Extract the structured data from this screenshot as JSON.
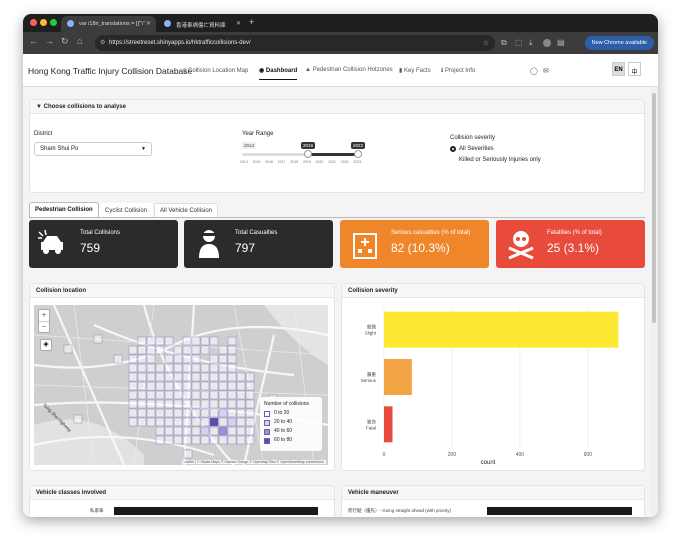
{
  "browser": {
    "tabs": [
      {
        "title": "var i18n_translations = [{\"\\\""
      },
      {
        "title": "香港車禍傷亡資料庫"
      }
    ],
    "url": "https://streetreset.shinyapps.io/hktrafficcollisions-dev/",
    "new_chrome_label": "New Chrome available"
  },
  "app": {
    "brand": "Hong Kong Traffic Injury Collision Database",
    "nav": [
      {
        "label": "Collision Location Map",
        "icon": "map-icon"
      },
      {
        "label": "Dashboard",
        "icon": "gauge-icon"
      },
      {
        "label": "Pedestrian Collision Hotzones",
        "icon": "warning-icon"
      },
      {
        "label": "Key Facts",
        "icon": "book-icon"
      },
      {
        "label": "Project Info",
        "icon": "info-icon"
      }
    ],
    "lang": {
      "en": "EN",
      "zh": "中"
    }
  },
  "filters": {
    "header": "Choose collisions to analyse",
    "district_label": "District",
    "district_value": "Sham Shui Po",
    "year_label": "Year Range",
    "year_min": "2014",
    "year_from": "2019",
    "year_to": "2023",
    "year_ticks": [
      "2014",
      "2015",
      "2016",
      "2017",
      "2018",
      "2019",
      "2020",
      "2021",
      "2022",
      "2023"
    ],
    "severity_label": "Collision severity",
    "severity_options": [
      "All Severities",
      "Killed or Seriously Injuries only"
    ],
    "severity_selected": "All Severities"
  },
  "tabs": [
    {
      "label": "Pedestrian Collision",
      "active": true
    },
    {
      "label": "Cyclist Collision",
      "active": false
    },
    {
      "label": "All Vehicle Collision",
      "active": false
    }
  ],
  "value_boxes": [
    {
      "title": "Total Collisions",
      "value": "759",
      "color": "#2b2b2b",
      "icon": "car-crash-icon"
    },
    {
      "title": "Total Casualties",
      "value": "797",
      "color": "#2b2b2b",
      "icon": "injured-person-icon"
    },
    {
      "title": "Serious casualties (% of total)",
      "value": "82 (10.3%)",
      "color": "#f0862a",
      "icon": "hospital-icon"
    },
    {
      "title": "Fatalities (% of total)",
      "value": "25 (3.1%)",
      "color": "#e84a3c",
      "icon": "skull-crossbones-icon"
    }
  ],
  "map_card": {
    "title": "Collision location",
    "legend_title": "Number of collisions",
    "legend": [
      "0 to 20",
      "20 to 40",
      "40 to 60",
      "60 to 80"
    ],
    "legend_colors": [
      "#ffffff",
      "#d6d1ee",
      "#9a8fd0",
      "#5b4cb0"
    ],
    "attribution": "Leaflet | © Stadia Maps © Stamen Design © OpenMapTiles © OpenStreetMap contributors",
    "place_label": "Tsing Sha Highway",
    "zoom_in": "+",
    "zoom_out": "−"
  },
  "severity_card": {
    "title": "Collision severity"
  },
  "chart_data": {
    "type": "bar",
    "orientation": "horizontal",
    "categories": [
      "Slight",
      "Serious",
      "Fatal"
    ],
    "category_labels_zh": [
      "輕微",
      "嚴重",
      "致命"
    ],
    "values": [
      690,
      82,
      25
    ],
    "colors": [
      "#fde833",
      "#f2a444",
      "#e84a3c"
    ],
    "xlabel": "count",
    "xticks": [
      0,
      200,
      400,
      600
    ],
    "xlim": [
      0,
      730
    ],
    "grid": true
  },
  "bottom_cards": [
    {
      "title": "Vehicle classes involved",
      "first_row": "私家車"
    },
    {
      "title": "Vehicle maneuver",
      "first_row": "而行駛（優先）- Going straight ahead (with priority)"
    }
  ]
}
